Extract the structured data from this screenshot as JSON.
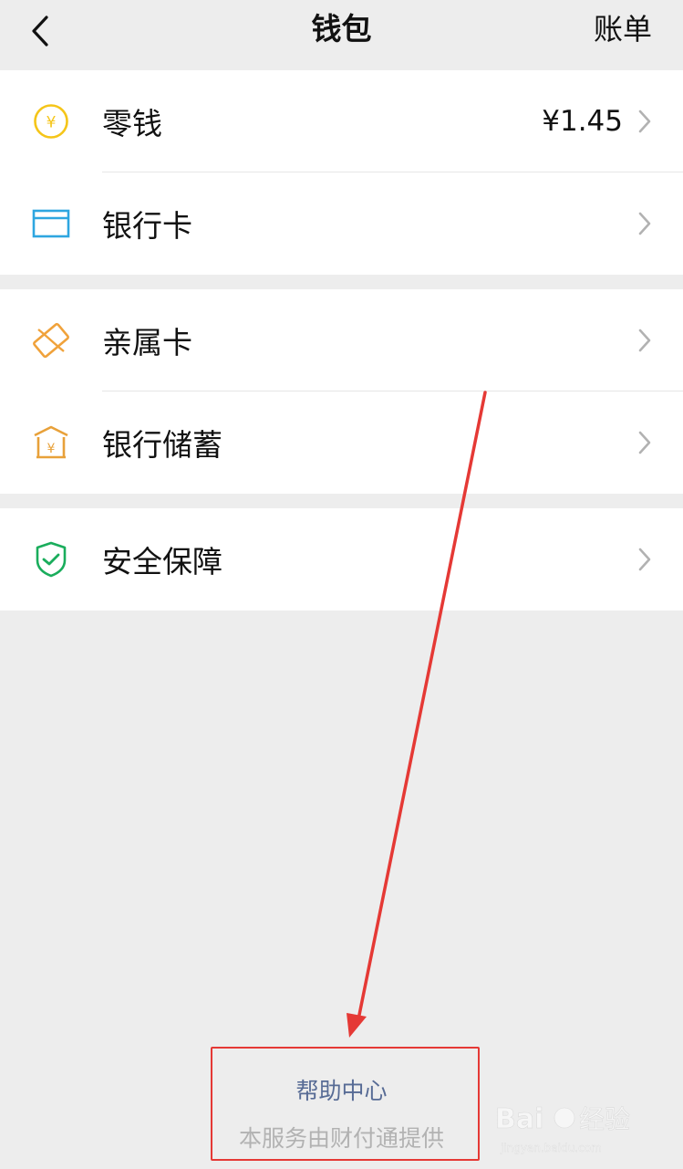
{
  "navbar": {
    "back_icon": "chevron-left-icon",
    "title": "钱包",
    "action_label": "账单"
  },
  "groups": [
    {
      "items": [
        {
          "icon": "yuan-coin-icon",
          "label": "零钱",
          "value": "¥1.45",
          "icon_color": "#f5c518"
        },
        {
          "icon": "bank-card-icon",
          "label": "银行卡",
          "value": "",
          "icon_color": "#2ea6e0"
        }
      ]
    },
    {
      "items": [
        {
          "icon": "family-card-icon",
          "label": "亲属卡",
          "value": "",
          "icon_color": "#f0a23b"
        },
        {
          "icon": "bank-savings-icon",
          "label": "银行储蓄",
          "value": "",
          "icon_color": "#e8a13a"
        }
      ]
    },
    {
      "items": [
        {
          "icon": "shield-check-icon",
          "label": "安全保障",
          "value": "",
          "icon_color": "#1aad5c"
        }
      ]
    }
  ],
  "footer": {
    "help_link": "帮助中心",
    "provider_note": "本服务由财付通提供"
  },
  "colors": {
    "background": "#ededed",
    "link": "#576b95",
    "annotation": "#e53935"
  }
}
